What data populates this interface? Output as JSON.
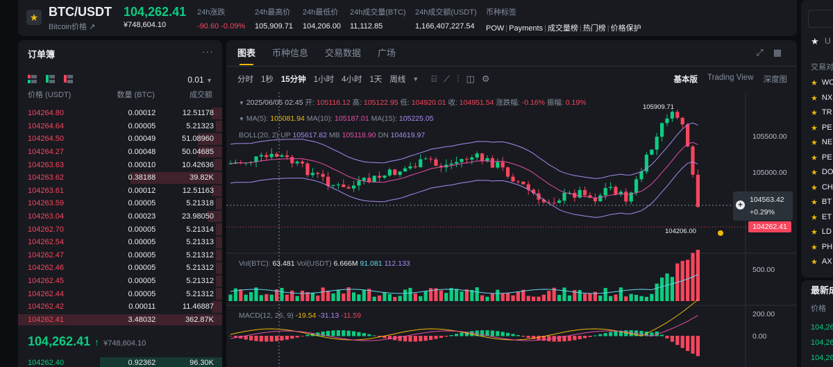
{
  "ticker": {
    "symbol": "BTC/USDT",
    "subname": "Bitcoin价格 ↗",
    "price": "104,262.41",
    "price_fiat": "¥748,604.10",
    "stats": [
      {
        "label": "24h涨跌",
        "value": "-90.60 -0.09%",
        "tone": "red"
      },
      {
        "label": "24h最高价",
        "value": "105,909.71",
        "tone": ""
      },
      {
        "label": "24h最低价",
        "value": "104,206.00",
        "tone": ""
      },
      {
        "label": "24h成交量(BTC)",
        "value": "11,112.85",
        "tone": ""
      },
      {
        "label": "24h成交额(USDT)",
        "value": "1,166,407,227.54",
        "tone": ""
      }
    ],
    "tags_label": "币种标签",
    "tags": [
      "POW",
      "Payments",
      "成交量榜",
      "热门榜",
      "价格保护"
    ]
  },
  "orderbook": {
    "title": "订单簿",
    "precision": "0.01",
    "col_price": "价格 (USDT)",
    "col_amount": "数量 (BTC)",
    "col_total": "成交额",
    "asks": [
      {
        "price": "104264.80",
        "amount": "0.00012",
        "total": "12.51178",
        "depth": 0.05
      },
      {
        "price": "104264.64",
        "amount": "0.00005",
        "total": "5.21323",
        "depth": 0.03
      },
      {
        "price": "104264.50",
        "amount": "0.00049",
        "total": "51.08960",
        "depth": 0.12
      },
      {
        "price": "104264.27",
        "amount": "0.00048",
        "total": "50.04685",
        "depth": 0.12
      },
      {
        "price": "104263.63",
        "amount": "0.00010",
        "total": "10.42636",
        "depth": 0.04
      },
      {
        "price": "104263.62",
        "amount": "0.38188",
        "total": "39.82K",
        "depth": 0.45
      },
      {
        "price": "104263.61",
        "amount": "0.00012",
        "total": "12.51163",
        "depth": 0.05
      },
      {
        "price": "104263.59",
        "amount": "0.00005",
        "total": "5.21318",
        "depth": 0.03
      },
      {
        "price": "104263.04",
        "amount": "0.00023",
        "total": "23.98050",
        "depth": 0.07
      },
      {
        "price": "104262.70",
        "amount": "0.00005",
        "total": "5.21314",
        "depth": 0.03
      },
      {
        "price": "104262.54",
        "amount": "0.00005",
        "total": "5.21313",
        "depth": 0.03
      },
      {
        "price": "104262.47",
        "amount": "0.00005",
        "total": "5.21312",
        "depth": 0.03
      },
      {
        "price": "104262.46",
        "amount": "0.00005",
        "total": "5.21312",
        "depth": 0.03
      },
      {
        "price": "104262.45",
        "amount": "0.00005",
        "total": "5.21312",
        "depth": 0.03
      },
      {
        "price": "104262.44",
        "amount": "0.00005",
        "total": "5.21312",
        "depth": 0.03
      },
      {
        "price": "104262.42",
        "amount": "0.00011",
        "total": "11.46887",
        "depth": 0.05
      },
      {
        "price": "104262.41",
        "amount": "3.48032",
        "total": "362.87K",
        "depth": 1.0
      }
    ],
    "last_price": "104,262.41",
    "last_arrow": "↑",
    "last_fiat": "¥748,604.10",
    "bids": [
      {
        "price": "104262.40",
        "amount": "0.92362",
        "total": "96.30K",
        "depth": 0.6
      }
    ]
  },
  "chart_panel": {
    "tabs": [
      "图表",
      "币种信息",
      "交易数据",
      "广场"
    ],
    "active_tab": "图表",
    "timeframes": [
      "分时",
      "1秒",
      "15分钟",
      "1小时",
      "4小时",
      "1天",
      "周线"
    ],
    "active_timeframe": "15分钟",
    "views": [
      "基本版",
      "Trading View",
      "深度图"
    ],
    "active_view": "基本版",
    "ohlc": {
      "date": "2025/06/05 02:45",
      "open_label": "开:",
      "open": "105116.12",
      "high_label": "高:",
      "high": "105122.95",
      "low_label": "低:",
      "low": "104920.01",
      "close_label": "收:",
      "close": "104951.54",
      "change_label": "涨跌幅:",
      "change": "-0.16%",
      "amp_label": "振幅:",
      "amp": "0.19%"
    },
    "ma": {
      "ma5_label": "MA(5):",
      "ma5": "105081.94",
      "ma10_label": "MA(10):",
      "ma10": "105187.01",
      "ma15_label": "MA(15):",
      "ma15": "105225.05"
    },
    "boll": {
      "label": "BOLL(20, 2)",
      "up_label": "UP",
      "up": "105617.82",
      "mb_label": "MB",
      "mb": "105118.90",
      "dn_label": "DN",
      "dn": "104619.97"
    },
    "vol": {
      "label_btc": "Vol(BTC):",
      "btc": "63.481",
      "label_usdt": "Vol(USDT)",
      "usdt": "6.666M",
      "v1": "91.081",
      "v2": "112.133"
    },
    "macd": {
      "label": "MACD(12, 26, 9)",
      "v1": "-19.54",
      "v2": "-31.13",
      "v3": "-11.59"
    },
    "y_axis": [
      "105500.00",
      "105000.00"
    ],
    "vol_axis": "500.00",
    "macd_axis": [
      "200.00",
      "0.00"
    ],
    "crosshair_price": "104563.42",
    "crosshair_pct": "+0.29%",
    "last_price": "104262.41",
    "high_mark": "105909.71",
    "low_mark": "104206.00",
    "colors": {
      "up": "#0ecb81",
      "down": "#f6465d",
      "accent": "#f0b90b"
    }
  },
  "right_panel": {
    "header": "交易对",
    "items": [
      "WO",
      "NX",
      "TR",
      "PE",
      "NE",
      "PE",
      "DO",
      "CH",
      "BT",
      "ET",
      "LD",
      "PH",
      "AX"
    ],
    "latest_title": "最新成",
    "latest_header": "价格",
    "latest_prices": [
      "104,26",
      "104,26",
      "104,26"
    ]
  }
}
